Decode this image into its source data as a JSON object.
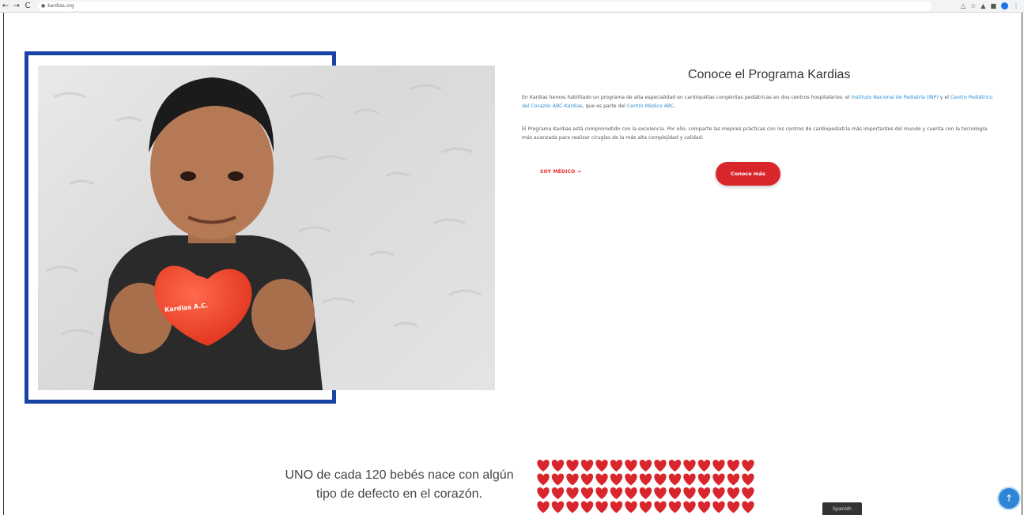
{
  "browser": {
    "url": "kardias.org",
    "back": "←",
    "forward": "→",
    "reload": "C",
    "lock": "🔒"
  },
  "content": {
    "heading": "Conoce el Programa Kardias",
    "paragraph1": {
      "t1": "En Kardias hemos habilitado un programa de alta especialidad en cardiopatías congénitas pediátricas en dos centros hospitalarios: el ",
      "link1": "Instituto Nacional de Pediatría (INP)",
      "t2": " y el ",
      "link2": "Centro Pediátrico del Corazón ABC-Kardias",
      "t3": ", que es parte del ",
      "link3": "Centro Médico ABC",
      "t4": "."
    },
    "paragraph2": "El Programa Kardias está comprometido con la excelencia. Por ello, comparte las mejores prácticas con los centros de cardiopediatría más importantes del mundo y cuenta con la tecnología más avanzada para realizar cirugías de la más alta complejidad y calidad.",
    "soy_medico": "SOY MÉDICO →",
    "conoce_mas": "Conoce más",
    "heart_toy_text": "Kardias A.C.",
    "stat_line1": "UNO de cada 120 bebés nace con algún",
    "stat_line2": "tipo de defecto en el corazón."
  },
  "widgets": {
    "language": "Spanish",
    "scroll_top_icon": "↑"
  },
  "colors": {
    "accent_red": "#d9262c",
    "frame_blue": "#1a43a8",
    "link_blue": "#2a8fd6"
  }
}
